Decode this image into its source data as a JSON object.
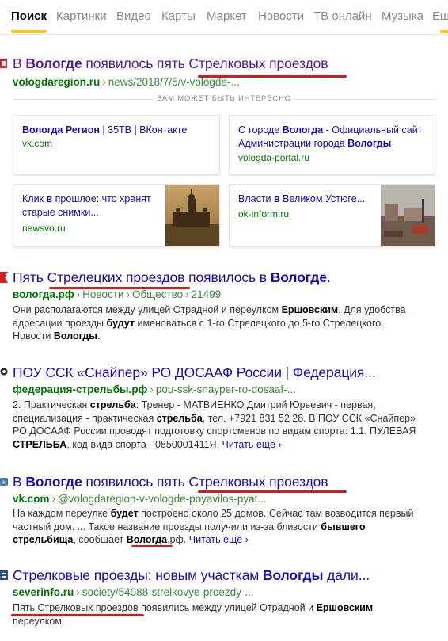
{
  "tabs": [
    "Поиск",
    "Картинки",
    "Видео",
    "Карты",
    "Маркет",
    "Новости",
    "ТВ онлайн",
    "Музыка",
    "Ещ"
  ],
  "colors": {
    "accent": "#f4c81e",
    "link": "#1a0dab",
    "visited": "#551a8b",
    "url": "#007700",
    "mark": "#d01c1c"
  },
  "results": [
    {
      "title_a": "В ",
      "title_b": "Вологде",
      "title_c": " появилось пять Стрелковых проездов",
      "domain": "vologdaregion.ru",
      "path": "news/2018/7/5/v-vologde-..."
    },
    {
      "title_a": "Пять Стрелецких проездов появилось в ",
      "title_b": "Вологде",
      "title_c": ".",
      "domain": "вологда.рф",
      "path": "Новости",
      "path2": "Общество",
      "path3": "21499",
      "snippet": {
        "t1": "Они располагаются между улицей Отрадной и переулком ",
        "b1": "Ершовским",
        "t2": ". Для удобства адресации проезды ",
        "b2": "будут",
        "t3": " именоваться с 1-го Стрелецкого до 5-го Стрелецкого.. Новости ",
        "b3": "Вологды",
        "t4": "."
      }
    },
    {
      "title": "ПОУ ССК «Снайпер» РО ДОСААФ России | Федерация...",
      "domain": "федерация-стрельбы.рф",
      "path": "pou-ssk-snayper-ro-dosaaf-...",
      "snippet": {
        "t1": "2. Практическая ",
        "b1": "стрельба",
        "t2": ": Тренер - МАТВИЕНКО Дмитрий Юрьевич - первая, специализация - практическая ",
        "b2": "стрельба",
        "t3": ", тел. +7921 831 52 28. В ПОУ ССК «Снайпер» РО ДОСААФ России проводят подготовку спортсменов по видам спорта: 1.1. ПУЛЕВАЯ ",
        "b3": "СТРЕЛЬБА",
        "t4": ", код вида спорта - 0850001411Я. ",
        "more": "Читать ещё ›"
      }
    },
    {
      "title_a": "В ",
      "title_b": "Вологде",
      "title_c": " появилось пять Стрелковых проездов",
      "domain": "vk.com",
      "path": "@vologdaregion-v-vologde-poyavilos-pyat...",
      "snippet": {
        "t1": "На каждом переулке ",
        "b1": "будет",
        "t2": " построено около 25 домов. Сейчас там возводится первый частный дом. ... Такое название проезды получили из-за близости ",
        "b2": "бывшего стрельбища",
        "t3": ", сообщает ",
        "b3": "Вологда",
        "t4": ".рф. ",
        "more": "Читать ещё ›"
      }
    },
    {
      "title_a": "Стрелковые проезды: новым участкам ",
      "title_b": "Вологды",
      "title_c": " дали...",
      "domain": "severinfo.ru",
      "path": "society/54088-strelkovye-proezdy-...",
      "snippet": {
        "t1": "Пять Стрелковых проездов появились между улицей Отрадной и ",
        "b1": "Ершовским",
        "t2": " переулком."
      }
    }
  ],
  "interest": {
    "heading": "ВАМ МОЖЕТ БЫТЬ ИНТЕРЕСНО",
    "cards": [
      {
        "title_b": "Вологда Регион",
        "title_c": " | 35ТВ | ВКонтакте",
        "domain": "vk.com"
      },
      {
        "title_a": "О городе ",
        "title_b": "Вологда",
        "title_c": " - Официальный сайт Администрации города ",
        "title_d": "Вологды",
        "domain": "vologda-portal.ru"
      },
      {
        "title_a": "Клик ",
        "title_b": "в",
        "title_c": " прошлое: что хранят старые снимки...",
        "domain": "newsvo.ru"
      },
      {
        "title_a": "Власти ",
        "title_b": "в",
        "title_c": " Великом Устюге...",
        "domain": "ok-inform.ru"
      }
    ]
  }
}
